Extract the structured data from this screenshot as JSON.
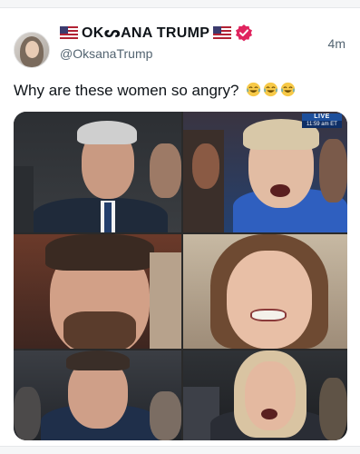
{
  "post": {
    "display_name": "OKᔕANA TRUMP",
    "handle": "@OksanaTrump",
    "time": "4m",
    "text": "Why are these women so angry?",
    "emoji": [
      "laughing-emoji",
      "laughing-emoji",
      "laughing-emoji"
    ]
  },
  "media": {
    "live_badge": {
      "label": "LIVE",
      "time": "11:59 am ET"
    }
  },
  "colors": {
    "verified_badge": "#e0245e",
    "handle_text": "#536471",
    "live_badge": "#1d4f9c"
  },
  "icons": {
    "flag_left": "us-flag-icon",
    "flag_right": "us-flag-icon",
    "verified": "verified-badge-icon"
  }
}
